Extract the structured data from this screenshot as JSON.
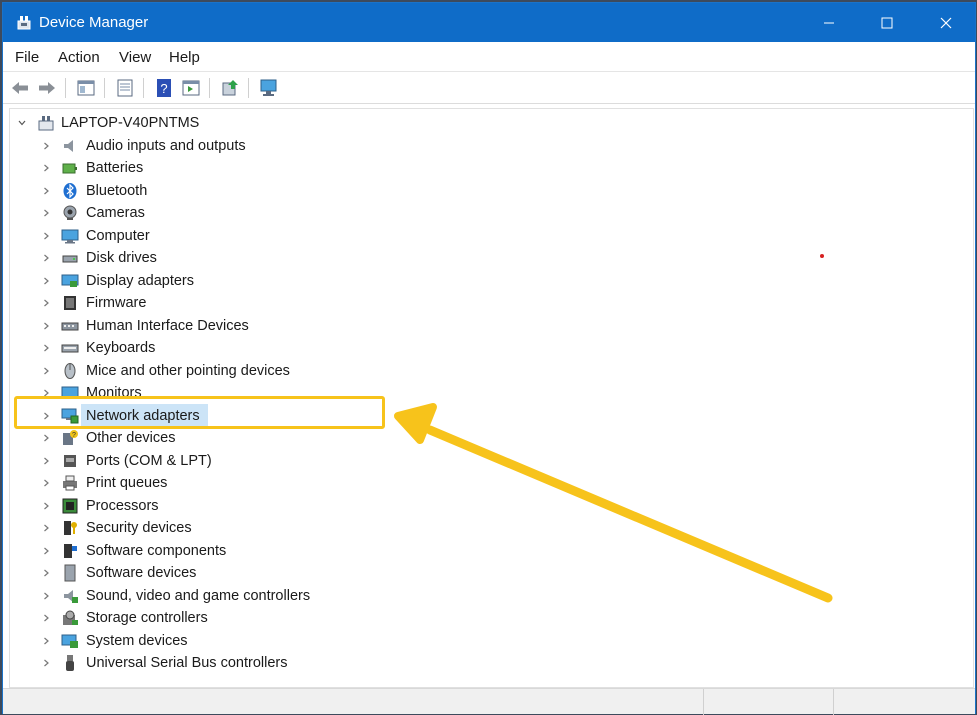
{
  "window": {
    "title": "Device Manager"
  },
  "menu": [
    "File",
    "Action",
    "View",
    "Help"
  ],
  "toolbar": {
    "icons": [
      "back-icon",
      "forward-icon",
      "show-hide-console-tree-icon",
      "properties-icon",
      "help-icon",
      "show-action-pane-icon",
      "update-driver-icon",
      "scan-hardware-icon"
    ]
  },
  "tree": {
    "root": "LAPTOP-V40PNTMS",
    "items": [
      {
        "label": "Audio inputs and outputs",
        "icon": "speaker-icon"
      },
      {
        "label": "Batteries",
        "icon": "battery-icon"
      },
      {
        "label": "Bluetooth",
        "icon": "bluetooth-icon"
      },
      {
        "label": "Cameras",
        "icon": "camera-icon"
      },
      {
        "label": "Computer",
        "icon": "computer-icon"
      },
      {
        "label": "Disk drives",
        "icon": "disk-drive-icon"
      },
      {
        "label": "Display adapters",
        "icon": "display-adapter-icon"
      },
      {
        "label": "Firmware",
        "icon": "firmware-icon"
      },
      {
        "label": "Human Interface Devices",
        "icon": "hid-icon"
      },
      {
        "label": "Keyboards",
        "icon": "keyboard-icon"
      },
      {
        "label": "Mice and other pointing devices",
        "icon": "mouse-icon"
      },
      {
        "label": "Monitors",
        "icon": "monitor-icon"
      },
      {
        "label": "Network adapters",
        "icon": "network-adapter-icon"
      },
      {
        "label": "Other devices",
        "icon": "unknown-device-icon"
      },
      {
        "label": "Ports (COM & LPT)",
        "icon": "port-icon"
      },
      {
        "label": "Print queues",
        "icon": "printer-icon"
      },
      {
        "label": "Processors",
        "icon": "processor-icon"
      },
      {
        "label": "Security devices",
        "icon": "security-device-icon"
      },
      {
        "label": "Software components",
        "icon": "software-component-icon"
      },
      {
        "label": "Software devices",
        "icon": "software-device-icon"
      },
      {
        "label": "Sound, video and game controllers",
        "icon": "sound-controller-icon"
      },
      {
        "label": "Storage controllers",
        "icon": "storage-controller-icon"
      },
      {
        "label": "System devices",
        "icon": "system-device-icon"
      },
      {
        "label": "Universal Serial Bus controllers",
        "icon": "usb-icon"
      }
    ],
    "selected": "Network adapters"
  },
  "colors": {
    "titlebar": "#0f6cc8",
    "highlight": "#f7c31b",
    "selection": "#cce4f7"
  }
}
